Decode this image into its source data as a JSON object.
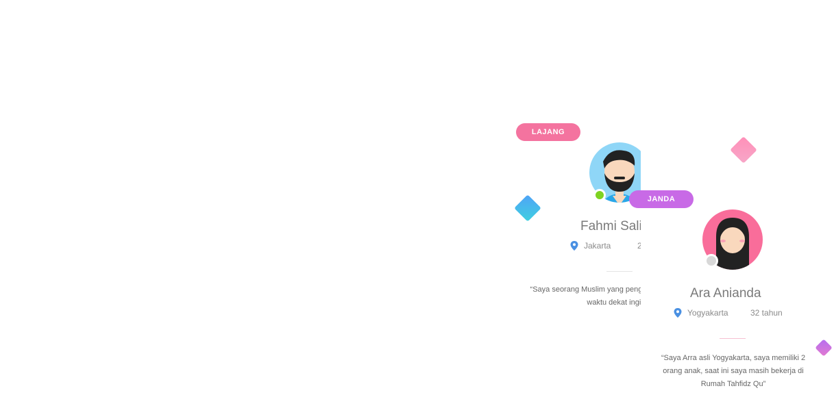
{
  "cards": [
    {
      "status_badge": "LAJANG",
      "name": "Fahmi Sali",
      "location": "Jakarta",
      "age": "2",
      "quote": "“Saya seorang Muslim yang pengajar di Kutab Al-Fatti waktu dekat ingin m",
      "online": true
    },
    {
      "status_badge": "JANDA",
      "name": "Ara Anianda",
      "location": "Yogyakarta",
      "age": "32 tahun",
      "quote": "“Saya Arra asli Yogyakarta, saya memiliki 2 orang anak, saat ini saya masih bekerja di Rumah Tahfidz Qu”",
      "online": false
    }
  ],
  "colors": {
    "lajang_badge": "#f4739f",
    "janda_badge": "#c86ae6",
    "online": "#7ed321",
    "offline": "#d8d8d8",
    "pin": "#4a90e2"
  },
  "icons": [
    "map-pin-icon",
    "diamond-decoration"
  ]
}
